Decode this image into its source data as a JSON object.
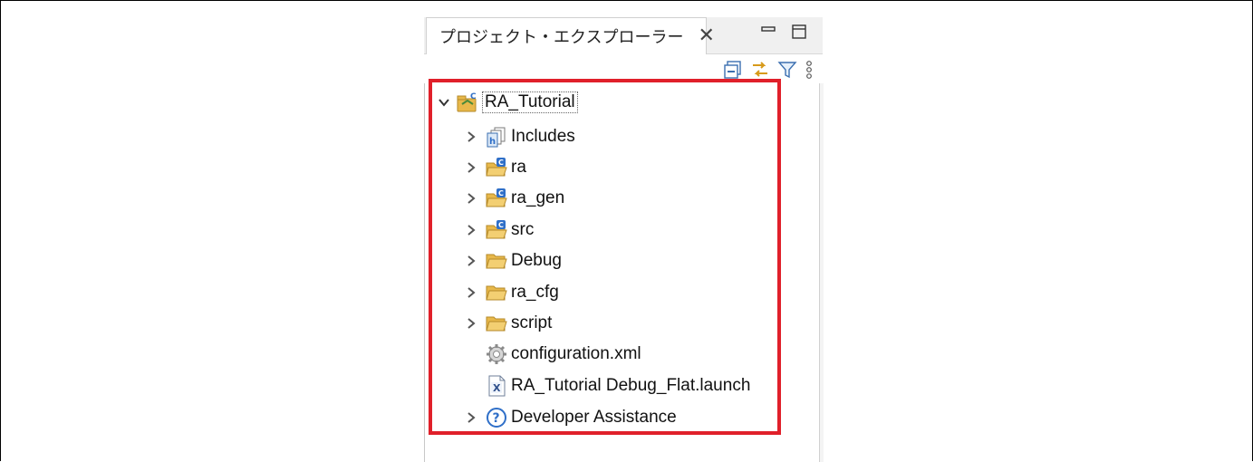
{
  "panel": {
    "tab_label": "プロジェクト・エクスプローラー",
    "tab_close": "✕"
  },
  "tree": {
    "root": {
      "label": "RA_Tutorial",
      "icon": "c-project-icon",
      "expanded": true
    },
    "items": [
      {
        "label": "Includes",
        "icon": "includes-icon",
        "expandable": true
      },
      {
        "label": "ra",
        "icon": "c-source-folder-icon",
        "expandable": true
      },
      {
        "label": "ra_gen",
        "icon": "c-source-folder-icon",
        "expandable": true
      },
      {
        "label": "src",
        "icon": "c-source-folder-icon",
        "expandable": true
      },
      {
        "label": "Debug",
        "icon": "folder-icon",
        "expandable": true
      },
      {
        "label": "ra_cfg",
        "icon": "folder-icon",
        "expandable": true
      },
      {
        "label": "script",
        "icon": "folder-icon",
        "expandable": true
      },
      {
        "label": "configuration.xml",
        "icon": "gear-icon",
        "expandable": false
      },
      {
        "label": "RA_Tutorial Debug_Flat.launch",
        "icon": "launch-file-icon",
        "expandable": false
      },
      {
        "label": "Developer Assistance",
        "icon": "help-icon",
        "expandable": true
      }
    ]
  },
  "colors": {
    "highlight": "#e0202a",
    "folder": "#e8b84a",
    "c_badge": "#2f6fc8"
  }
}
